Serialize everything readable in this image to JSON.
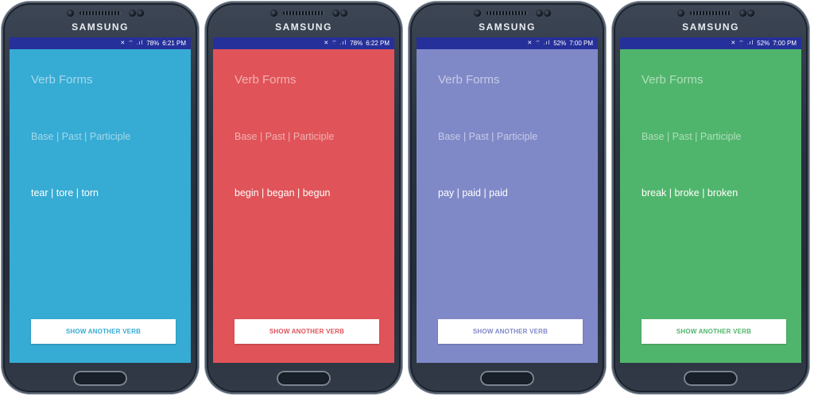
{
  "phones": [
    {
      "brand": "SAMSUNG",
      "status": {
        "icons": "✕ ⌔ .ıl",
        "battery": "78%",
        "time": "6:21 PM"
      },
      "bg": "#36abd4",
      "accent": "#36abd4",
      "title": "Verb Forms",
      "header": "Base | Past | Participle",
      "forms": "tear | tore | torn",
      "button": "SHOW ANOTHER VERB"
    },
    {
      "brand": "SAMSUNG",
      "status": {
        "icons": "✕ ⌔ .ıl",
        "battery": "78%",
        "time": "6:22 PM"
      },
      "bg": "#e05358",
      "accent": "#e05358",
      "title": "Verb Forms",
      "header": "Base | Past | Participle",
      "forms": "begin | began | begun",
      "button": "SHOW ANOTHER VERB"
    },
    {
      "brand": "SAMSUNG",
      "status": {
        "icons": "✕ ⌔ .ıl",
        "battery": "52%",
        "time": "7:00 PM"
      },
      "bg": "#8089c8",
      "accent": "#8089c8",
      "title": "Verb Forms",
      "header": "Base | Past | Participle",
      "forms": "pay | paid | paid",
      "button": "SHOW ANOTHER VERB"
    },
    {
      "brand": "SAMSUNG",
      "status": {
        "icons": "✕ ⌔ .ıl",
        "battery": "52%",
        "time": "7:00 PM"
      },
      "bg": "#50b56c",
      "accent": "#50b56c",
      "title": "Verb Forms",
      "header": "Base | Past | Participle",
      "forms": "break | broke | broken",
      "button": "SHOW ANOTHER VERB"
    }
  ]
}
